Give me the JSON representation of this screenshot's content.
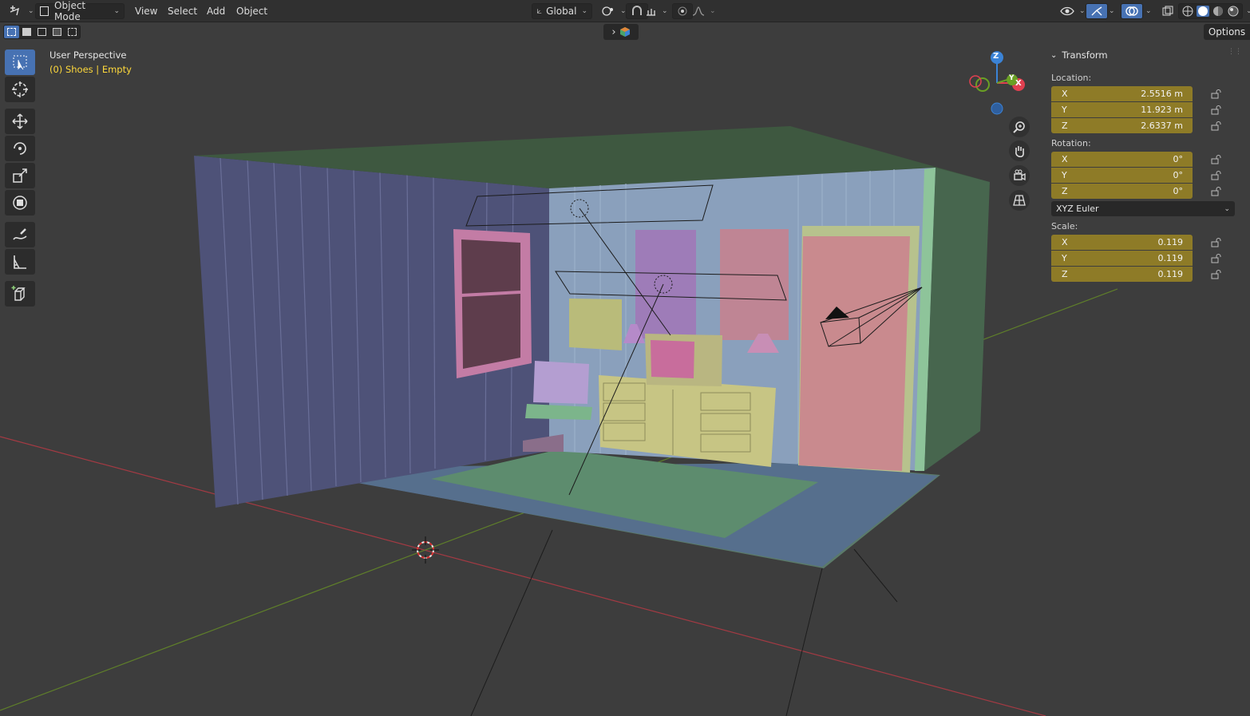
{
  "header": {
    "mode": "Object Mode",
    "menus": [
      "View",
      "Select",
      "Add",
      "Object"
    ],
    "orientation": "Global"
  },
  "subrow": {
    "options_label": "Options"
  },
  "viewport": {
    "perspective": "User Perspective",
    "context": "(0) Shoes | Empty"
  },
  "gizmo": {
    "z": "Z",
    "y": "Y",
    "x": "X"
  },
  "tools": [
    "select-box-icon",
    "cursor-icon",
    "move-icon",
    "rotate-icon",
    "scale-icon",
    "transform-icon",
    "annotate-icon",
    "measure-icon",
    "add-cube-icon"
  ],
  "transform": {
    "title": "Transform",
    "location_label": "Location:",
    "rotation_label": "Rotation:",
    "scale_label": "Scale:",
    "location": [
      {
        "axis": "X",
        "value": "2.5516 m"
      },
      {
        "axis": "Y",
        "value": "11.923 m"
      },
      {
        "axis": "Z",
        "value": "2.6337 m"
      }
    ],
    "rotation": [
      {
        "axis": "X",
        "value": "0°"
      },
      {
        "axis": "Y",
        "value": "0°"
      },
      {
        "axis": "Z",
        "value": "0°"
      }
    ],
    "rotation_mode": "XYZ Euler",
    "scale": [
      {
        "axis": "X",
        "value": "0.119"
      },
      {
        "axis": "Y",
        "value": "0.119"
      },
      {
        "axis": "Z",
        "value": "0.119"
      }
    ]
  },
  "colors": {
    "accent": "#4772b3",
    "field": "#8e7b27",
    "x_axis": "#e04050",
    "y_axis": "#6aa024",
    "z_axis": "#3b83d6"
  }
}
